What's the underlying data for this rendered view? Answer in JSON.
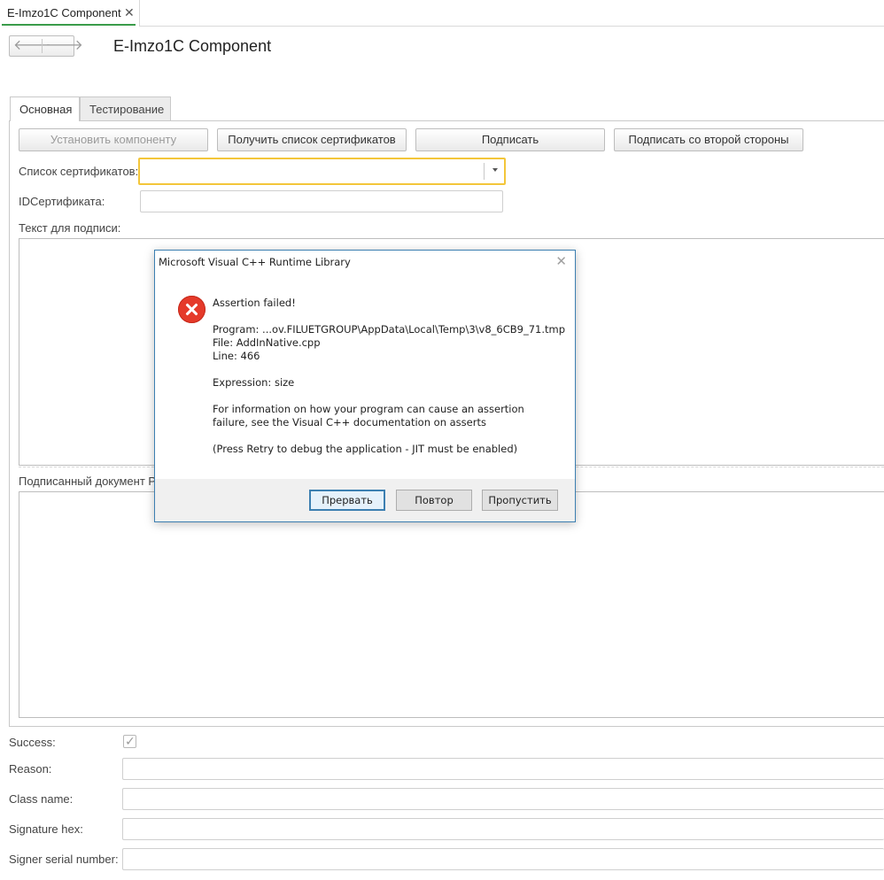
{
  "tab": {
    "title": "E-Imzo1C Component",
    "close_glyph": "✕"
  },
  "nav": {
    "back_icon": "arrow-left-icon",
    "forward_icon": "arrow-right-icon",
    "back_glyph": "🡐",
    "forward_glyph": "🡒"
  },
  "form_title": "E-Imzo1C Component",
  "form_tabs": [
    "Основная",
    "Тестирование"
  ],
  "buttons": {
    "install": "Установить компоненту",
    "get_certs": "Получить список сертификатов",
    "sign": "Подписать",
    "cosign": "Подписать со второй стороны"
  },
  "fields": {
    "cert_list_label": "Список сертификатов:",
    "cert_list_value": "",
    "cert_id_label": "IDСертификата:",
    "cert_id_value": "",
    "text_to_sign_label": "Текст для подписи:",
    "signed_doc_label": "Подписанный документ P",
    "success_label": "Success:",
    "success_checked": true,
    "reason_label": "Reason:",
    "reason_value": "",
    "class_name_label": "Class name:",
    "class_name_value": "",
    "signature_hex_label": "Signature hex:",
    "signature_hex_value": "",
    "signer_serial_label": "Signer serial number:",
    "signer_serial_value": ""
  },
  "dialog": {
    "title": "Microsoft Visual C++ Runtime Library",
    "close_glyph": "✕",
    "icon": "error-icon",
    "lines": {
      "heading": "Assertion failed!",
      "program": "Program: ...ov.FILUETGROUP\\AppData\\Local\\Temp\\3\\v8_6CB9_71.tmp",
      "file": "File: AddInNative.cpp",
      "line": "Line: 466",
      "expression": "Expression: size",
      "info1": "For information on how your program can cause an assertion",
      "info2": "failure, see the Visual C++ documentation on asserts",
      "retry_hint": "(Press Retry to debug the application - JIT must be enabled)"
    },
    "buttons": {
      "abort": "Прервать",
      "retry": "Повтор",
      "ignore": "Пропустить"
    }
  },
  "colors": {
    "focus_border": "#f3c63a",
    "tab_underline": "#3a9c4a",
    "dialog_border": "#3c7fb1",
    "error_red": "#e53a2a"
  }
}
